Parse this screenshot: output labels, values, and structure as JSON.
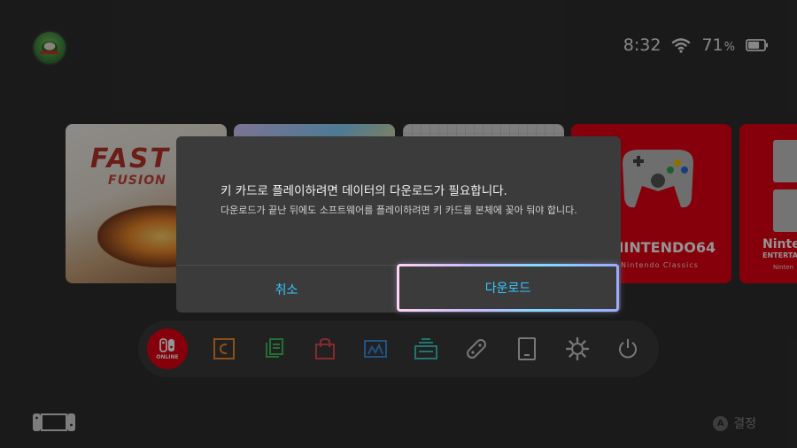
{
  "status_bar": {
    "time": "8:32",
    "battery_percent": "71",
    "percent_sign": "%",
    "wifi_icon": "wifi-icon",
    "battery_icon": "battery-icon"
  },
  "tiles": {
    "fast": {
      "title": "FAST",
      "subtitle": "FUSION"
    },
    "n64": {
      "title": "NINTENDO64",
      "subtitle": "Nintendo Classics"
    },
    "nes": {
      "title": "Ninte",
      "subtitle": "ENTERTA",
      "subtitle2": "Ninten"
    }
  },
  "dock": {
    "online_label": "ONLINE",
    "items": [
      {
        "name": "nintendo-switch-online",
        "icon": "switch-online-icon"
      },
      {
        "name": "news",
        "icon": "news-icon"
      },
      {
        "name": "virtual-game-cards",
        "icon": "game-card-icon"
      },
      {
        "name": "eshop",
        "icon": "shop-bag-icon"
      },
      {
        "name": "album",
        "icon": "album-icon"
      },
      {
        "name": "game-share",
        "icon": "gamechat-icon"
      },
      {
        "name": "controllers",
        "icon": "controller-icon"
      },
      {
        "name": "sleep-mode-tablet",
        "icon": "tablet-icon"
      },
      {
        "name": "system-settings",
        "icon": "gear-icon"
      },
      {
        "name": "power",
        "icon": "power-icon"
      }
    ]
  },
  "dialog": {
    "title": "키 카드로 플레이하려면 데이터의 다운로드가 필요합니다.",
    "body": "다운로드가 끝난 뒤에도 소프트웨어를 플레이하려면 키 카드를 본체에 꽂아 둬야 합니다.",
    "cancel_label": "취소",
    "download_label": "다운로드"
  },
  "footer": {
    "a_button": "A",
    "confirm_label": "결정"
  },
  "colors": {
    "accent": "#35c9ff",
    "nintendo_red": "#e60012"
  }
}
